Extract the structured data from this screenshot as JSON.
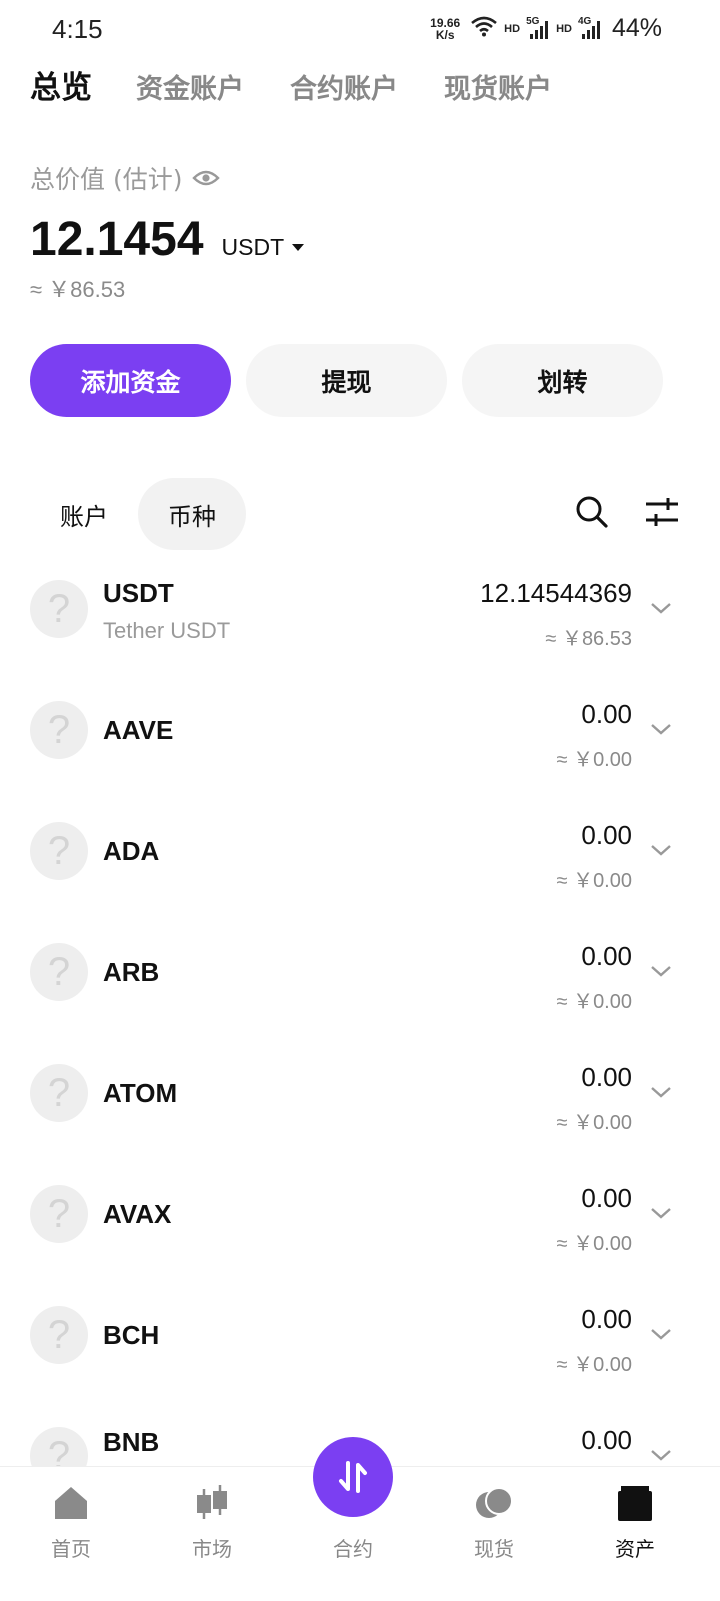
{
  "status_bar": {
    "time": "4:15",
    "net_speed_value": "19.66",
    "net_speed_unit": "K/s",
    "hd_label_1": "HD",
    "signal_gen_1": "5G",
    "hd_label_2": "HD",
    "signal_gen_2": "4G",
    "battery": "44%"
  },
  "top_tabs": [
    {
      "label": "总览",
      "active": true
    },
    {
      "label": "资金账户",
      "active": false
    },
    {
      "label": "合约账户",
      "active": false
    },
    {
      "label": "现货账户",
      "active": false
    }
  ],
  "total": {
    "label": "总价值 (估计)",
    "value": "12.1454",
    "currency": "USDT",
    "approx": "≈ ￥86.53"
  },
  "actions": {
    "add_funds": "添加资金",
    "withdraw": "提现",
    "transfer": "划转"
  },
  "list_tabs": [
    {
      "label": "账户",
      "active": false
    },
    {
      "label": "币种",
      "active": true
    }
  ],
  "assets": [
    {
      "symbol": "USDT",
      "name": "Tether USDT",
      "amount": "12.14544369",
      "fiat": "≈ ￥86.53",
      "logo": "?"
    },
    {
      "symbol": "AAVE",
      "name": "",
      "amount": "0.00",
      "fiat": "≈ ￥0.00",
      "logo": "?"
    },
    {
      "symbol": "ADA",
      "name": "",
      "amount": "0.00",
      "fiat": "≈ ￥0.00",
      "logo": "?"
    },
    {
      "symbol": "ARB",
      "name": "",
      "amount": "0.00",
      "fiat": "≈ ￥0.00",
      "logo": "?"
    },
    {
      "symbol": "ATOM",
      "name": "",
      "amount": "0.00",
      "fiat": "≈ ￥0.00",
      "logo": "?"
    },
    {
      "symbol": "AVAX",
      "name": "",
      "amount": "0.00",
      "fiat": "≈ ￥0.00",
      "logo": "?"
    },
    {
      "symbol": "BCH",
      "name": "",
      "amount": "0.00",
      "fiat": "≈ ￥0.00",
      "logo": "?"
    },
    {
      "symbol": "BNB",
      "name": "",
      "amount": "0.00",
      "fiat": "",
      "logo": "?"
    }
  ],
  "bottom_nav": [
    {
      "label": "首页",
      "icon": "home-icon",
      "active": false
    },
    {
      "label": "市场",
      "icon": "candlestick-icon",
      "active": false
    },
    {
      "label": "合约",
      "icon": "swap-arrows-icon",
      "active": false
    },
    {
      "label": "现货",
      "icon": "coins-icon",
      "active": false
    },
    {
      "label": "资产",
      "icon": "wallet-icon",
      "active": true
    }
  ],
  "colors": {
    "accent": "#7b3ff2",
    "muted_text": "#9a9a9a",
    "chip_bg": "#f5f5f5"
  }
}
